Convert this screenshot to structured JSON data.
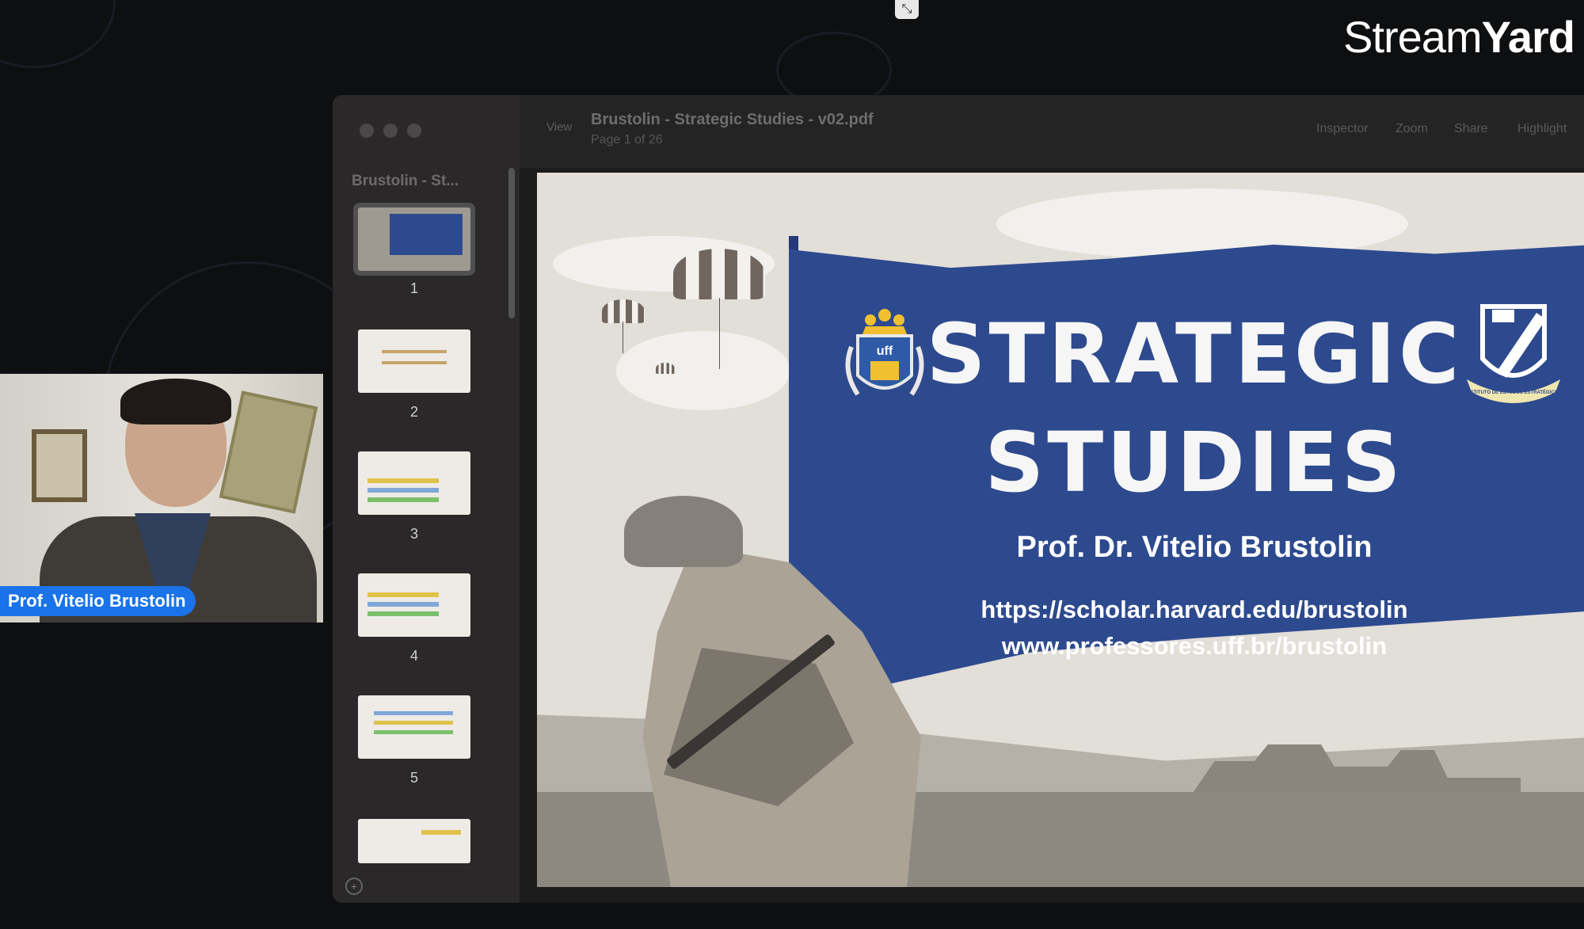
{
  "app": {
    "brand_light": "Stream",
    "brand_bold": "Yard"
  },
  "participant": {
    "name": "Prof. Vitelio Brustolin"
  },
  "viewer": {
    "view_label": "View",
    "document_title": "Brustolin - Strategic Studies - v02.pdf",
    "page_indicator": "Page 1 of 26",
    "sidebar_title": "Brustolin - St...",
    "toolbar_buttons": [
      "Inspector",
      "Zoom",
      "Share",
      "Highlight"
    ],
    "thumbnails": [
      {
        "number": "1",
        "selected": true
      },
      {
        "number": "2",
        "selected": false
      },
      {
        "number": "3",
        "selected": false
      },
      {
        "number": "4",
        "selected": false
      },
      {
        "number": "5",
        "selected": false
      },
      {
        "number": "",
        "selected": false
      }
    ]
  },
  "slide": {
    "title_line1": "STRATEGIC",
    "title_line2": "STUDIES",
    "author": "Prof. Dr. Vitelio Brustolin",
    "link1": "https://scholar.harvard.edu/brustolin",
    "link2": "www.professores.uff.br/brustolin",
    "crest_left_text": "uff",
    "crest_right_text": "INSTITUTO DE ESTUDOS ESTRATÉGICOS"
  },
  "colors": {
    "flag_blue": "#2e4a8e",
    "tag_blue": "#1a73e8",
    "background": "#0e0f11"
  }
}
